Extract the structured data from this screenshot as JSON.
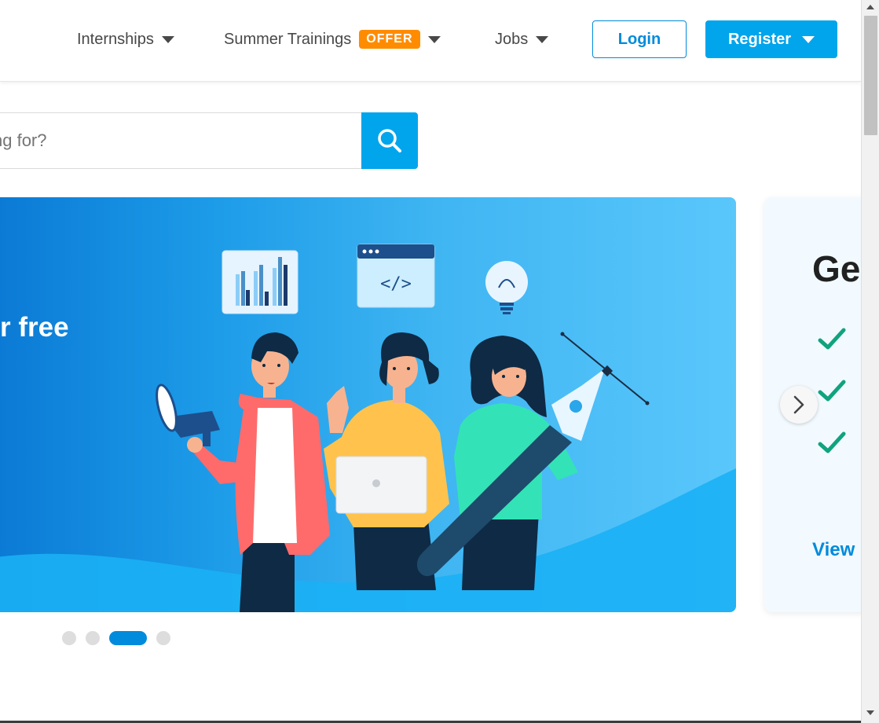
{
  "header": {
    "nav": [
      {
        "label": "Internships",
        "icon": "chevron-down-icon"
      },
      {
        "label": "Summer Trainings",
        "badge": "OFFER",
        "icon": "chevron-down-icon"
      },
      {
        "label": "Jobs",
        "icon": "chevron-down-icon"
      }
    ],
    "login_label": "Login",
    "register_label": "Register"
  },
  "search": {
    "placeholder": "ng for?",
    "button_icon": "search-icon"
  },
  "banner": {
    "text": "r free"
  },
  "side_card": {
    "title": "Ge",
    "checks": [
      "check-icon",
      "check-icon",
      "check-icon"
    ],
    "link": "View"
  },
  "carousel": {
    "dots": 4,
    "active_index": 3
  },
  "colors": {
    "brand_blue": "#008bdc",
    "accent_blue": "#00a5ec",
    "offer_orange": "#ff8c00",
    "check_green": "#10a37f"
  }
}
